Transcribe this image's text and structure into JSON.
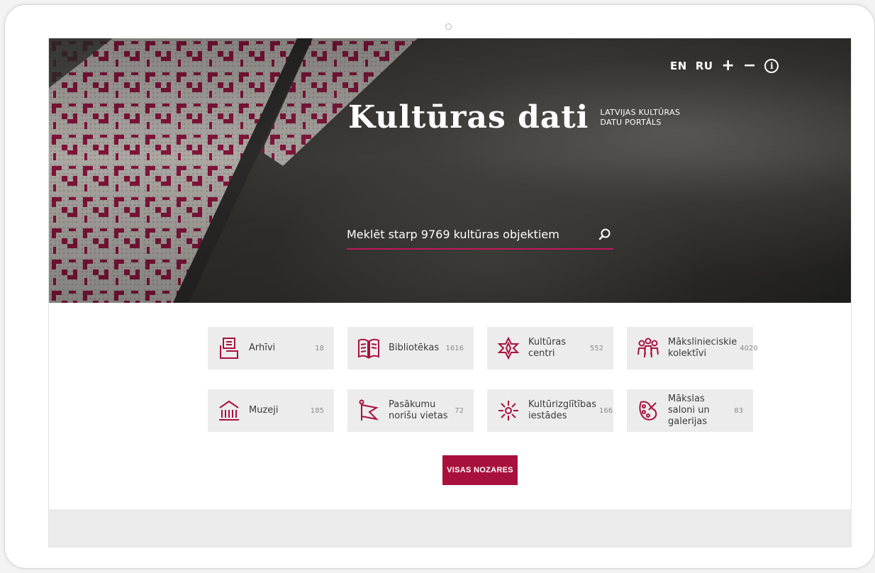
{
  "header": {
    "languages": [
      "EN",
      "RU"
    ],
    "zoom_in": "+",
    "zoom_out": "−",
    "info_icon": "info-icon"
  },
  "logo": {
    "title": "Kultūras dati",
    "subtitle_line1": "LATVIJAS KULTŪRAS",
    "subtitle_line2": "DATU PORTĀLS"
  },
  "search": {
    "placeholder": "Meklēt starp 9769 kultūras objektiem",
    "icon": "search-icon"
  },
  "categories": [
    {
      "label": "Arhīvi",
      "count": "18",
      "icon": "archive-icon"
    },
    {
      "label": "Bibliotēkas",
      "count": "1616",
      "icon": "library-book-icon"
    },
    {
      "label": "Kultūras centri",
      "count": "552",
      "icon": "culture-center-star-icon"
    },
    {
      "label": "Mākslinieciskie kolektīvi",
      "count": "4020",
      "icon": "art-groups-people-icon"
    },
    {
      "label": "Muzeji",
      "count": "185",
      "icon": "museum-icon"
    },
    {
      "label": "Pasākumu norišu vietas",
      "count": "72",
      "icon": "event-venue-flag-icon"
    },
    {
      "label": "Kultūrizglītības iestādes",
      "count": "166",
      "icon": "education-sun-icon"
    },
    {
      "label": "Mākslas saloni un galerijas",
      "count": "83",
      "icon": "art-gallery-palette-icon"
    }
  ],
  "all_button": "VISAS NOZARES",
  "colors": {
    "accent": "#a8113e",
    "search_underline": "#c2185b",
    "card_bg": "#ececec",
    "icon": "#a8113e"
  }
}
